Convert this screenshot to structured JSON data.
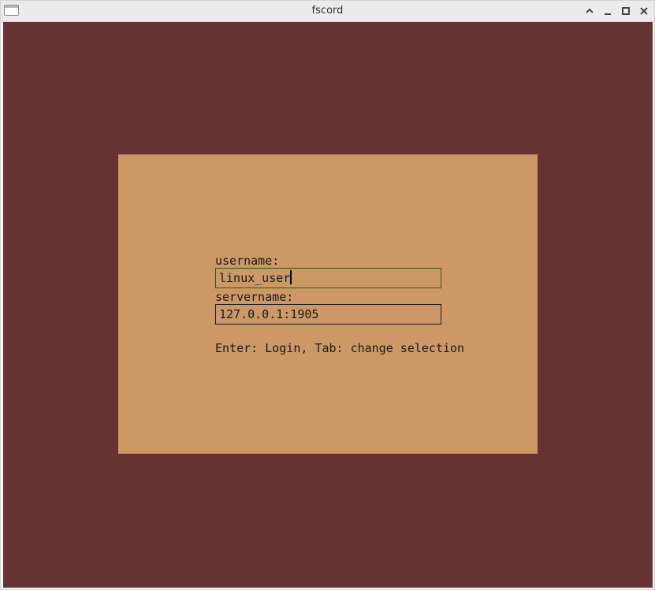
{
  "window": {
    "title": "fscord",
    "icon": "app-window-icon",
    "controls": [
      "shade-icon",
      "minimize-icon",
      "maximize-icon",
      "close-icon"
    ]
  },
  "colors": {
    "background": "#663333",
    "dialog": "#cc9966",
    "active_field_border": "#2d5a10"
  },
  "login": {
    "username_label": "username:",
    "username_value": "linux_user",
    "servername_label": "servername:",
    "servername_value": "127.0.0.1:1905",
    "hint": "Enter: Login, Tab: change selection"
  }
}
